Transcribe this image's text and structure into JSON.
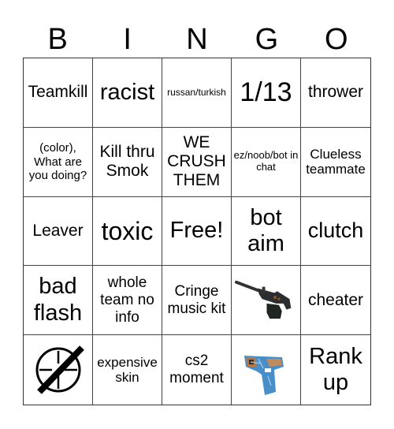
{
  "header": [
    "B",
    "I",
    "N",
    "G",
    "O"
  ],
  "cells": [
    {
      "text": "Teamkill"
    },
    {
      "text": "racist"
    },
    {
      "text": "russan/turkish"
    },
    {
      "text": "1/13"
    },
    {
      "text": "thrower"
    },
    {
      "text": "(color), What are you doing?"
    },
    {
      "text": "Kill thru Smok"
    },
    {
      "text": "WE CRUSH THEM"
    },
    {
      "text": "ez/noob/bot in chat"
    },
    {
      "text": "Clueless teammate"
    },
    {
      "text": "Leaver"
    },
    {
      "text": "toxic"
    },
    {
      "text": "Free!"
    },
    {
      "text": "bot aim"
    },
    {
      "text": "clutch"
    },
    {
      "text": "bad flash"
    },
    {
      "text": "whole team no info"
    },
    {
      "text": "Cringe music kit"
    },
    {
      "image": "machine-gun-skin-icon"
    },
    {
      "text": "cheater"
    },
    {
      "image": "no-crosshair-icon"
    },
    {
      "text": "expensive skin"
    },
    {
      "text": "cs2 moment"
    },
    {
      "image": "pistol-skin-icon"
    },
    {
      "text": "Rank up"
    }
  ]
}
